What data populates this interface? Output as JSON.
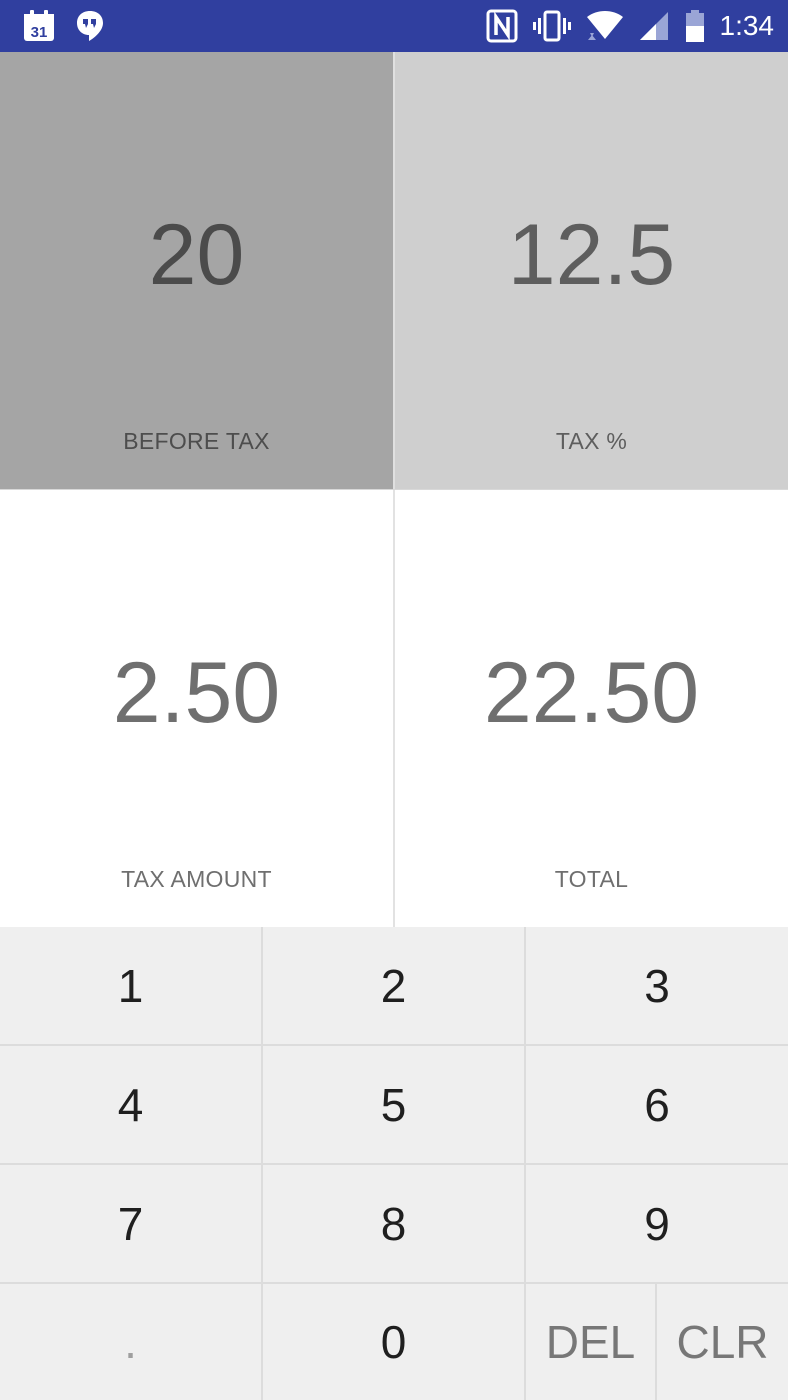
{
  "status_bar": {
    "time": "1:34",
    "calendar_day": "31",
    "icons": [
      "calendar-icon",
      "hangouts-icon",
      "nfc-icon",
      "vibrate-icon",
      "wifi-icon",
      "signal-icon",
      "battery-icon"
    ],
    "background_color": "#303F9F"
  },
  "display": {
    "before_tax": {
      "value": "20",
      "label": "BEFORE TAX"
    },
    "tax_percent": {
      "value": "12.5",
      "label": "TAX %"
    },
    "tax_amount": {
      "value": "2.50",
      "label": "TAX AMOUNT"
    },
    "total": {
      "value": "22.50",
      "label": "TOTAL"
    }
  },
  "keypad": {
    "k1": "1",
    "k2": "2",
    "k3": "3",
    "k4": "4",
    "k5": "5",
    "k6": "6",
    "k7": "7",
    "k8": "8",
    "k9": "9",
    "kdot": ".",
    "k0": "0",
    "kdel": "DEL",
    "kclr": "CLR"
  }
}
